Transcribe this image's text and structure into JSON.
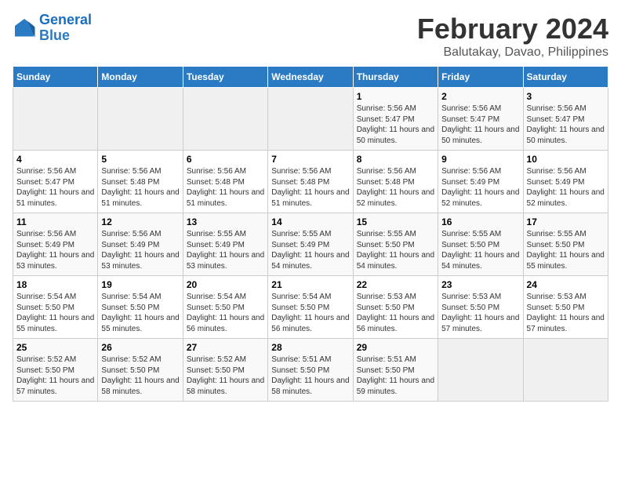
{
  "logo": {
    "line1": "General",
    "line2": "Blue"
  },
  "title": "February 2024",
  "location": "Balutakay, Davao, Philippines",
  "headers": [
    "Sunday",
    "Monday",
    "Tuesday",
    "Wednesday",
    "Thursday",
    "Friday",
    "Saturday"
  ],
  "weeks": [
    [
      {
        "day": "",
        "info": ""
      },
      {
        "day": "",
        "info": ""
      },
      {
        "day": "",
        "info": ""
      },
      {
        "day": "",
        "info": ""
      },
      {
        "day": "1",
        "info": "Sunrise: 5:56 AM\nSunset: 5:47 PM\nDaylight: 11 hours and 50 minutes."
      },
      {
        "day": "2",
        "info": "Sunrise: 5:56 AM\nSunset: 5:47 PM\nDaylight: 11 hours and 50 minutes."
      },
      {
        "day": "3",
        "info": "Sunrise: 5:56 AM\nSunset: 5:47 PM\nDaylight: 11 hours and 50 minutes."
      }
    ],
    [
      {
        "day": "4",
        "info": "Sunrise: 5:56 AM\nSunset: 5:47 PM\nDaylight: 11 hours and 51 minutes."
      },
      {
        "day": "5",
        "info": "Sunrise: 5:56 AM\nSunset: 5:48 PM\nDaylight: 11 hours and 51 minutes."
      },
      {
        "day": "6",
        "info": "Sunrise: 5:56 AM\nSunset: 5:48 PM\nDaylight: 11 hours and 51 minutes."
      },
      {
        "day": "7",
        "info": "Sunrise: 5:56 AM\nSunset: 5:48 PM\nDaylight: 11 hours and 51 minutes."
      },
      {
        "day": "8",
        "info": "Sunrise: 5:56 AM\nSunset: 5:48 PM\nDaylight: 11 hours and 52 minutes."
      },
      {
        "day": "9",
        "info": "Sunrise: 5:56 AM\nSunset: 5:49 PM\nDaylight: 11 hours and 52 minutes."
      },
      {
        "day": "10",
        "info": "Sunrise: 5:56 AM\nSunset: 5:49 PM\nDaylight: 11 hours and 52 minutes."
      }
    ],
    [
      {
        "day": "11",
        "info": "Sunrise: 5:56 AM\nSunset: 5:49 PM\nDaylight: 11 hours and 53 minutes."
      },
      {
        "day": "12",
        "info": "Sunrise: 5:56 AM\nSunset: 5:49 PM\nDaylight: 11 hours and 53 minutes."
      },
      {
        "day": "13",
        "info": "Sunrise: 5:55 AM\nSunset: 5:49 PM\nDaylight: 11 hours and 53 minutes."
      },
      {
        "day": "14",
        "info": "Sunrise: 5:55 AM\nSunset: 5:49 PM\nDaylight: 11 hours and 54 minutes."
      },
      {
        "day": "15",
        "info": "Sunrise: 5:55 AM\nSunset: 5:50 PM\nDaylight: 11 hours and 54 minutes."
      },
      {
        "day": "16",
        "info": "Sunrise: 5:55 AM\nSunset: 5:50 PM\nDaylight: 11 hours and 54 minutes."
      },
      {
        "day": "17",
        "info": "Sunrise: 5:55 AM\nSunset: 5:50 PM\nDaylight: 11 hours and 55 minutes."
      }
    ],
    [
      {
        "day": "18",
        "info": "Sunrise: 5:54 AM\nSunset: 5:50 PM\nDaylight: 11 hours and 55 minutes."
      },
      {
        "day": "19",
        "info": "Sunrise: 5:54 AM\nSunset: 5:50 PM\nDaylight: 11 hours and 55 minutes."
      },
      {
        "day": "20",
        "info": "Sunrise: 5:54 AM\nSunset: 5:50 PM\nDaylight: 11 hours and 56 minutes."
      },
      {
        "day": "21",
        "info": "Sunrise: 5:54 AM\nSunset: 5:50 PM\nDaylight: 11 hours and 56 minutes."
      },
      {
        "day": "22",
        "info": "Sunrise: 5:53 AM\nSunset: 5:50 PM\nDaylight: 11 hours and 56 minutes."
      },
      {
        "day": "23",
        "info": "Sunrise: 5:53 AM\nSunset: 5:50 PM\nDaylight: 11 hours and 57 minutes."
      },
      {
        "day": "24",
        "info": "Sunrise: 5:53 AM\nSunset: 5:50 PM\nDaylight: 11 hours and 57 minutes."
      }
    ],
    [
      {
        "day": "25",
        "info": "Sunrise: 5:52 AM\nSunset: 5:50 PM\nDaylight: 11 hours and 57 minutes."
      },
      {
        "day": "26",
        "info": "Sunrise: 5:52 AM\nSunset: 5:50 PM\nDaylight: 11 hours and 58 minutes."
      },
      {
        "day": "27",
        "info": "Sunrise: 5:52 AM\nSunset: 5:50 PM\nDaylight: 11 hours and 58 minutes."
      },
      {
        "day": "28",
        "info": "Sunrise: 5:51 AM\nSunset: 5:50 PM\nDaylight: 11 hours and 58 minutes."
      },
      {
        "day": "29",
        "info": "Sunrise: 5:51 AM\nSunset: 5:50 PM\nDaylight: 11 hours and 59 minutes."
      },
      {
        "day": "",
        "info": ""
      },
      {
        "day": "",
        "info": ""
      }
    ]
  ]
}
